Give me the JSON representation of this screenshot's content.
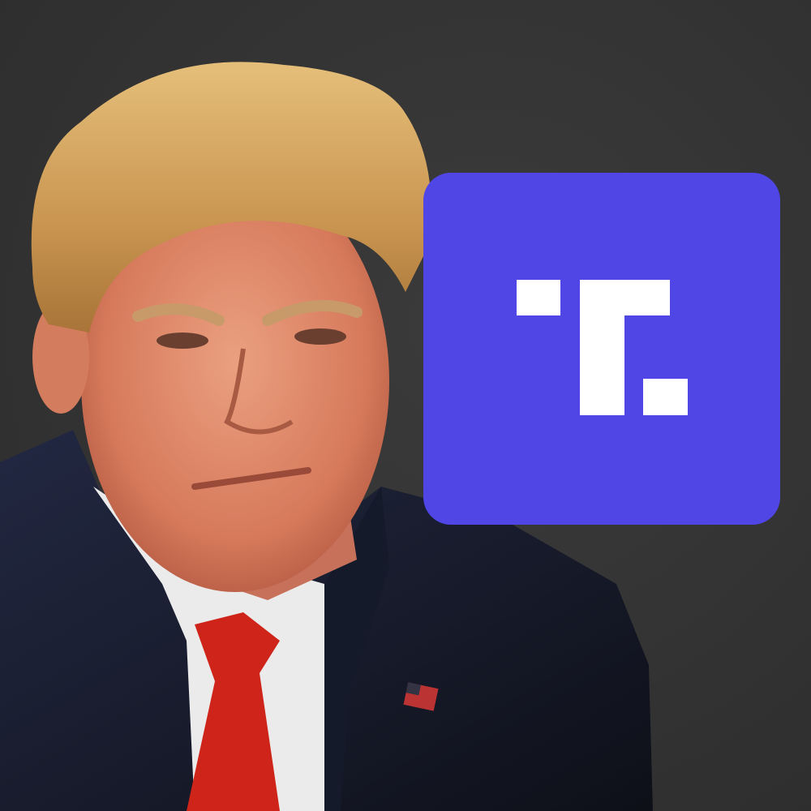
{
  "scene": {
    "background_color": "#333333",
    "subject": "portrait-photo",
    "colors": {
      "hair": "#d9a85a",
      "skin": "#e0876a",
      "suit": "#1a1e2e",
      "shirt": "#eeeeee",
      "tie": "#d42a1e",
      "pin": "american-flag"
    }
  },
  "logo": {
    "icon": "t-letter-logo-icon",
    "tile_color": "#5046e6",
    "glyph_color": "#ffffff"
  }
}
